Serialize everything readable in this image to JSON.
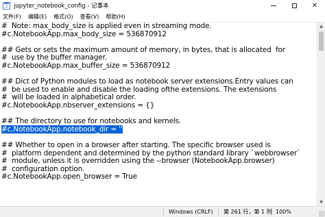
{
  "window": {
    "title": "jupyter_notebook_config - 记事本",
    "minimize": "—",
    "maximize": "□",
    "close": "✕"
  },
  "menu": {
    "items": [
      "文件(F)",
      "编辑(E)",
      "格式(O)",
      "查看(V)",
      "帮助(H)"
    ]
  },
  "editor": {
    "lines": [
      "#  Note: max_body_size is applied even in streaming mode.",
      "#c.NotebookApp.max_body_size = 536870912",
      "",
      "## Gets or sets the maximum amount of memory, in bytes, that is allocated  for",
      "#  use by the buffer manager.",
      "#c.NotebookApp.max_buffer_size = 536870912",
      "",
      "## Dict of Python modules to load as notebook server extensions.Entry values can",
      "#  be used to enable and disable the loading ofthe extensions. The extensions",
      "#  will be loaded in alphabetical order.",
      "#c.NotebookApp.nbserver_extensions = {}",
      "",
      "## The directory to use for notebooks and kernels.",
      "#c.NotebookApp.notebook_dir = ''",
      "",
      "## Whether to open in a browser after starting. The specific browser used is",
      "#  platform dependent and determined by the python standard library `webbrowser`",
      "#  module, unless it is overridden using the --browser (NotebookApp.browser)",
      "#  configuration option.",
      "#c.NotebookApp.open_browser = True",
      "",
      "",
      ""
    ],
    "selected_line": "#c.NotebookApp.notebook_dir = ''"
  },
  "status": {
    "encoding_eol": "Windows (CRLF)",
    "position": "第 261 行，第 1 列",
    "zoom": "100%"
  },
  "colors": {
    "selection": "#0a64d6",
    "statusbar": "#f0f0f0"
  }
}
